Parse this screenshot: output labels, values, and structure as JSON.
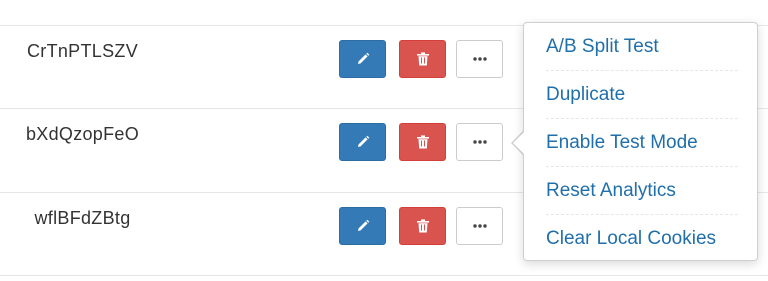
{
  "rows": [
    {
      "name": "CrTnPTLSZV"
    },
    {
      "name": "bXdQzopFeO"
    },
    {
      "name": "wflBFdZBtg"
    }
  ],
  "row_actions": {
    "edit_icon": "pencil-icon",
    "delete_icon": "trash-icon",
    "more_icon": "ellipsis-icon"
  },
  "dropdown_menu": {
    "items": [
      {
        "label": "A/B Split Test"
      },
      {
        "label": "Duplicate"
      },
      {
        "label": "Enable Test Mode"
      },
      {
        "label": "Reset Analytics"
      },
      {
        "label": "Clear Local Cookies"
      }
    ]
  },
  "colors": {
    "edit_button": "#337ab7",
    "delete_button": "#d9534f",
    "menu_link": "#1f6fab"
  }
}
